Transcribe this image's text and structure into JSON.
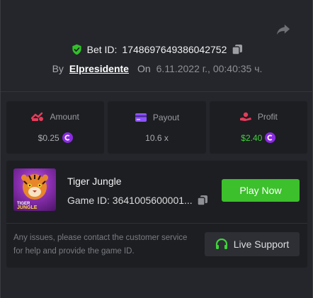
{
  "bet": {
    "label": "Bet ID:",
    "id": "1748697649386042752"
  },
  "byline": {
    "by_label": "By",
    "username": "Elpresidente",
    "on_label": "On",
    "date": "6.11.2022 г., 00:40:35 ч."
  },
  "stats": [
    {
      "label": "Amount",
      "value": "$0.25",
      "icon": "coins-icon",
      "has_coin": true
    },
    {
      "label": "Payout",
      "value": "10.6 x",
      "icon": "card-icon",
      "has_coin": false
    },
    {
      "label": "Profit",
      "value": "$2.40",
      "icon": "hand-coin-icon",
      "has_coin": true
    }
  ],
  "game": {
    "title": "Tiger Jungle",
    "id_label": "Game ID: 3641005600001...",
    "thumb_text_1": "TIGER",
    "thumb_text_2": "JUNGLE",
    "play_label": "Play Now"
  },
  "support": {
    "text": "Any issues, please contact the customer service for help and provide the game ID.",
    "button_label": "Live Support"
  },
  "colors": {
    "background": "#24262b",
    "panel": "#1c1e22",
    "accent_green": "#3cc02c",
    "profit_green": "#3fd43a",
    "coin_purple": "#8a2be2",
    "amount_red": "#e63c5a",
    "payout_purple": "#8c52ff"
  }
}
